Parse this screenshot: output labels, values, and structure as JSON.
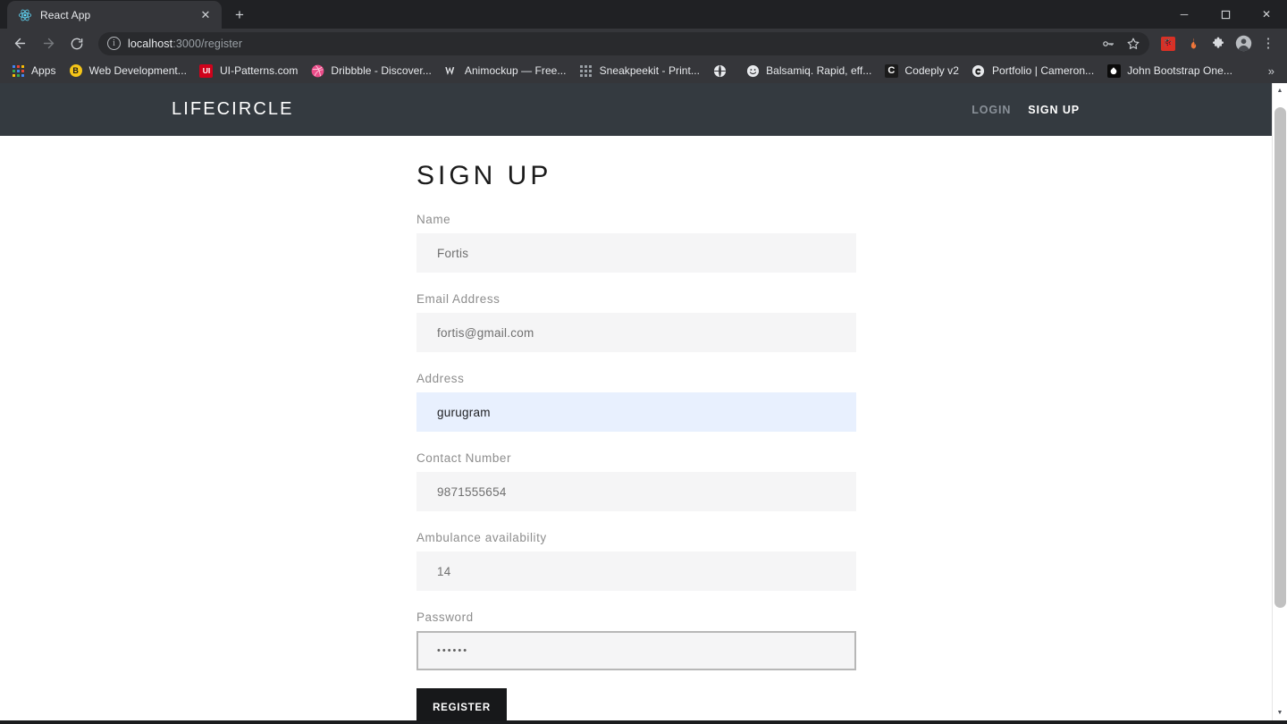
{
  "browser": {
    "tab": {
      "title": "React App",
      "favicon": "react-logo-icon",
      "close_label": "✕"
    },
    "new_tab_label": "+",
    "window_controls": {
      "minimize": "─",
      "maximize": "❐",
      "close": "✕"
    },
    "toolbar": {
      "back": "←",
      "forward": "→",
      "reload": "⟳",
      "url_host": "localhost",
      "url_rest": ":3000/register",
      "info_glyph": "i",
      "key_icon": "password-key-icon",
      "star_icon": "bookmark-star-icon",
      "menu_glyph": "⋮"
    },
    "extensions": [
      {
        "name": "extension-red-icon",
        "glyph": "🐞",
        "color": "#d93025"
      },
      {
        "name": "extension-flame-icon",
        "glyph": "🔥",
        "color": "#35363a"
      },
      {
        "name": "extension-puzzle-icon",
        "glyph": "🧩",
        "color": "#35363a"
      },
      {
        "name": "profile-avatar-icon",
        "glyph": "",
        "color": "#9aa0a6"
      }
    ],
    "bookmarks": {
      "overflow_label": "»",
      "items": [
        {
          "label": "Apps",
          "icon": "apps-grid-icon",
          "icon_glyph": "",
          "icon_bg": "transparent",
          "icon_color": "#e8eaed"
        },
        {
          "label": "Web Development...",
          "icon": "favicon-circle-icon",
          "icon_glyph": "Ⓑ",
          "icon_bg": "#f5c518",
          "icon_color": "#1b1b1b"
        },
        {
          "label": "UI-Patterns.com",
          "icon": "ui-patterns-icon",
          "icon_glyph": "UI",
          "icon_bg": "#d0021b",
          "icon_color": "#ffffff"
        },
        {
          "label": "Dribbble - Discover...",
          "icon": "dribbble-icon",
          "icon_glyph": "●",
          "icon_bg": "transparent",
          "icon_color": "#ea4c89"
        },
        {
          "label": "Animockup — Free...",
          "icon": "animockup-icon",
          "icon_glyph": "ⱛ",
          "icon_bg": "transparent",
          "icon_color": "#e8eaed"
        },
        {
          "label": "Sneakpeekit - Print...",
          "icon": "sneakpeekit-grid-icon",
          "icon_glyph": "∷",
          "icon_bg": "transparent",
          "icon_color": "#9aa0a6"
        },
        {
          "label": "",
          "icon": "globe-icon",
          "icon_glyph": "🌐",
          "icon_bg": "transparent",
          "icon_color": "#e8eaed"
        },
        {
          "label": "Balsamiq. Rapid, eff...",
          "icon": "balsamiq-smiley-icon",
          "icon_glyph": "☺",
          "icon_bg": "transparent",
          "icon_color": "#e8eaed"
        },
        {
          "label": "Codeply v2",
          "icon": "codeply-icon",
          "icon_glyph": "C",
          "icon_bg": "#1b1b1b",
          "icon_color": "#ffffff"
        },
        {
          "label": "Portfolio | Cameron...",
          "icon": "portfolio-icon",
          "icon_glyph": "◔",
          "icon_bg": "#e8eaed",
          "icon_color": "#1b1b1b"
        },
        {
          "label": "John Bootstrap One...",
          "icon": "john-bootstrap-icon",
          "icon_glyph": "♠",
          "icon_bg": "#0b0b0b",
          "icon_color": "#ffffff"
        }
      ]
    },
    "scrollbar": {
      "up_arrow": "▲",
      "down_arrow": "▼"
    }
  },
  "site": {
    "navbar": {
      "brand": "LIFECIRCLE",
      "links": [
        {
          "label": "LOGIN",
          "state": "inactive"
        },
        {
          "label": "SIGN UP",
          "state": "active"
        }
      ]
    },
    "form": {
      "title": "SIGN UP",
      "fields": [
        {
          "label": "Name",
          "value": "Fortis",
          "placeholder": "Name",
          "state": "filled",
          "type": "text"
        },
        {
          "label": "Email Address",
          "value": "fortis@gmail.com",
          "placeholder": "Email Address",
          "state": "filled",
          "type": "email"
        },
        {
          "label": "Address",
          "value": "gurugram",
          "placeholder": "Address",
          "state": "autofill",
          "type": "text"
        },
        {
          "label": "Contact Number",
          "value": "9871555654",
          "placeholder": "Contact Number",
          "state": "filled",
          "type": "tel"
        },
        {
          "label": "Ambulance availability",
          "value": "14",
          "placeholder": "Ambulance availability",
          "state": "filled",
          "type": "number"
        },
        {
          "label": "Password",
          "value": "••••••",
          "placeholder": "Password",
          "state": "focused",
          "type": "password"
        }
      ],
      "submit_label": "REGISTER"
    }
  },
  "colors": {
    "chrome_dark": "#35363a",
    "chrome_darker": "#202124",
    "site_navbar": "#343a40",
    "field_bg": "#f5f5f6",
    "autofill_bg": "#e8f0fe",
    "button_bg": "#17181a",
    "label_gray": "#8d8d8d"
  }
}
